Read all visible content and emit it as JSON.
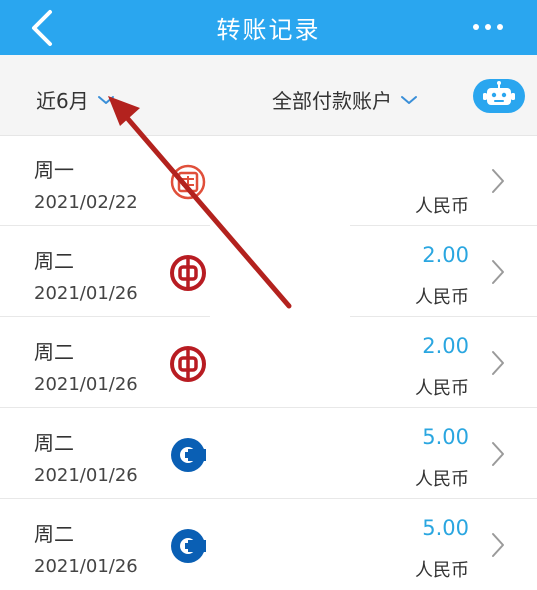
{
  "header": {
    "title": "转账记录",
    "back_icon": "chevron-left-icon",
    "more_icon": "more-dots-icon"
  },
  "filters": {
    "period": "近6月",
    "account": "全部付款账户",
    "assistant_icon": "robot-icon"
  },
  "records": [
    {
      "weekday": "周一",
      "date": "2021/02/22",
      "bank": "red-seal-bank-icon",
      "amount": "",
      "currency": "人民币"
    },
    {
      "weekday": "周二",
      "date": "2021/01/26",
      "bank": "bank-of-china-icon",
      "amount": "2.00",
      "currency": "人民币"
    },
    {
      "weekday": "周二",
      "date": "2021/01/26",
      "bank": "bank-of-china-icon",
      "amount": "2.00",
      "currency": "人民币"
    },
    {
      "weekday": "周二",
      "date": "2021/01/26",
      "bank": "ccb-icon",
      "amount": "5.00",
      "currency": "人民币"
    },
    {
      "weekday": "周二",
      "date": "2021/01/26",
      "bank": "ccb-icon",
      "amount": "5.00",
      "currency": "人民币"
    }
  ],
  "colors": {
    "header_bg": "#2aa6ef",
    "amount": "#2aa6e0",
    "annotation_arrow": "#b3221e",
    "boc_red": "#b81c22",
    "ccb_blue": "#0a5fb4"
  }
}
